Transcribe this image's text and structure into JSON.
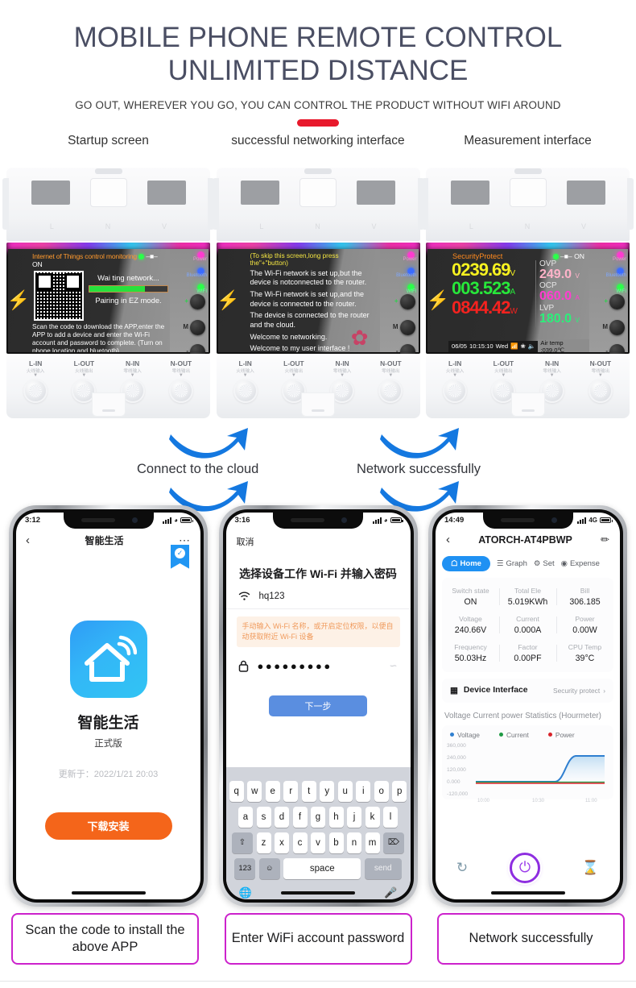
{
  "header": {
    "title": "MOBILE PHONE REMOTE CONTROL UNLIMITED DISTANCE",
    "subtitle": "GO OUT, WHEREVER YOU GO, YOU CAN CONTROL THE PRODUCT WITHOUT WIFI AROUND",
    "accent_color": "#e8192c",
    "title_color": "#4a4e63"
  },
  "devices": [
    {
      "caption": "Startup screen",
      "screen": {
        "title": "Internet of Things control monitoring",
        "switch_label": "ON",
        "waiting": "Wai ting network...",
        "progress_percent": 71,
        "pairing": "Pairing in EZ mode.",
        "footer": "Scan the code to download the APP,enter the APP to add a device and enter the Wi-Fi account and password to complete. (Turn on phone location and bluetooth)"
      }
    },
    {
      "caption": "successful networking interface",
      "screen": {
        "hint": "(To skip this screen,long press the\"+\"button)",
        "lines": [
          "The Wi-Fi network is set up,but the device is notconnected to the router.",
          "The Wi-Fi network is set up,and the device is connected to the router.",
          "The device is connected to the router and the cloud.",
          "Welcome to networking.",
          "Welcome to my user interface !"
        ]
      }
    },
    {
      "caption": "Measurement interface",
      "screen": {
        "mode": "SecurityProtect",
        "switch_label": "ON",
        "readings": [
          {
            "value": "0239.69",
            "unit": "V",
            "color": "#f7f220"
          },
          {
            "value": "003.523",
            "unit": "A",
            "color": "#27e83a"
          },
          {
            "value": "0844.42",
            "unit": "W",
            "color": "#f5221f"
          }
        ],
        "limits": [
          {
            "key": "OVP",
            "value": "249.0",
            "unit": "V"
          },
          {
            "key": "OCP",
            "value": "060.0",
            "unit": "A"
          },
          {
            "key": "LVP",
            "value": "180.0",
            "unit": "V"
          }
        ],
        "status_date": "06/05",
        "status_time": "10:15:10",
        "status_day": "Wed",
        "air_temp": "Air temp :039.0℃"
      }
    }
  ],
  "device_leds": {
    "power": "Power",
    "bluetooth": "Bluetooth",
    "wifi": "WIFI"
  },
  "device_buttons": {
    "plus": "+",
    "m": "M",
    "minus": "-"
  },
  "terminals": [
    {
      "label": "L-IN",
      "cn": "火线输入"
    },
    {
      "label": "L-OUT",
      "cn": "火线输出"
    },
    {
      "label": "N-IN",
      "cn": "零线输入"
    },
    {
      "label": "N-OUT",
      "cn": "零线输出"
    }
  ],
  "arrows": {
    "left_label": "Connect to the cloud",
    "right_label": "Network successfully",
    "color": "#1478e0"
  },
  "phone1": {
    "status_time": "3:12",
    "nav_title": "智能生活",
    "back_icon": "chevron-left-icon",
    "more_icon": "more-horizontal-icon",
    "badge_icon": "verified-check-icon",
    "app_icon": "smart-home-wifi-icon",
    "app_name": "智能生活",
    "app_version": "正式版",
    "updated": "更新于：2022/1/21 20:03",
    "download_label": "下载安装",
    "download_color": "#f4651a"
  },
  "phone2": {
    "status_time": "3:16",
    "cancel_label": "取消",
    "title": "选择设备工作 Wi-Fi 并输入密码",
    "wifi_icon": "wifi-icon",
    "ssid": "hq123",
    "ssid_placeholder": "Wi-Fi",
    "warning": "手动输入 Wi-Fi 名称，或开启定位权限，以便自动获取附近 Wi-Fi 设备",
    "lock_icon": "lock-icon",
    "password_masked": "●●●●●●●●●",
    "eye_icon": "eye-off-icon",
    "next_label": "下一步",
    "keyboard": {
      "row1": [
        "q",
        "w",
        "e",
        "r",
        "t",
        "y",
        "u",
        "i",
        "o",
        "p"
      ],
      "row2": [
        "a",
        "s",
        "d",
        "f",
        "g",
        "h",
        "j",
        "k",
        "l"
      ],
      "row3": [
        "z",
        "x",
        "c",
        "v",
        "b",
        "n",
        "m"
      ],
      "shift": "⇧",
      "backspace": "⌦",
      "numbers": "123",
      "emoji": "☺",
      "space": "space",
      "send": "send",
      "globe": "globe-icon",
      "mic": "microphone-icon"
    }
  },
  "phone3": {
    "status_time": "14:49",
    "network": "4G",
    "nav_title": "ATORCH-AT4PBWP",
    "back_icon": "chevron-left-icon",
    "edit_icon": "pencil-icon",
    "tabs": [
      {
        "label": "Home",
        "icon": "home-icon",
        "active": true
      },
      {
        "label": "Graph",
        "icon": "chart-icon",
        "active": false
      },
      {
        "label": "Set",
        "icon": "gear-icon",
        "active": false
      },
      {
        "label": "Expense",
        "icon": "clock-icon",
        "active": false
      }
    ],
    "metrics": [
      [
        {
          "key": "Switch state",
          "value": "ON"
        },
        {
          "key": "Total Ele",
          "value": "5.019KWh"
        },
        {
          "key": "Bill",
          "value": "306.185"
        }
      ],
      [
        {
          "key": "Voltage",
          "value": "240.66V"
        },
        {
          "key": "Current",
          "value": "0.000A"
        },
        {
          "key": "Power",
          "value": "0.00W"
        }
      ],
      [
        {
          "key": "Frequency",
          "value": "50.03Hz"
        },
        {
          "key": "Factor",
          "value": "0.00PF"
        },
        {
          "key": "CPU Temp",
          "value": "39°C"
        }
      ]
    ],
    "device_interface": {
      "icon": "grid-icon",
      "label": "Device Interface",
      "value": "Security protect",
      "chevron": "chevron-right-icon"
    },
    "controls": {
      "timer_icon": "timer-icon",
      "power_icon": "power-icon",
      "hourglass_icon": "hourglass-icon",
      "power_color": "#8e2ee0"
    }
  },
  "chart_data": {
    "type": "line",
    "title": "Voltage Current power Statistics (Hourmeter)",
    "legend": [
      {
        "name": "Voltage",
        "color": "#2f7fd0"
      },
      {
        "name": "Current",
        "color": "#1f9a44"
      },
      {
        "name": "Power",
        "color": "#d8232a"
      }
    ],
    "legend_position": "top",
    "grid": false,
    "ylabel": "",
    "xlabel": "",
    "ylim": [
      -120000,
      360000
    ],
    "yticks": [
      "360,000",
      "240,000",
      "120,000",
      "0.000",
      "-120,000"
    ],
    "xticks": [
      "10:00",
      "10:30",
      "11:00"
    ],
    "x": [
      0,
      1,
      2,
      3,
      4,
      5,
      6,
      7,
      8,
      9,
      10
    ],
    "series": [
      {
        "name": "Voltage",
        "values": [
          0,
          0,
          0,
          0,
          0,
          0,
          0,
          140000,
          245000,
          243000,
          243000
        ]
      },
      {
        "name": "Current",
        "values": [
          0,
          0,
          0,
          0,
          0,
          0,
          0,
          0,
          0,
          0,
          0
        ]
      },
      {
        "name": "Power",
        "values": [
          0,
          0,
          0,
          0,
          0,
          0,
          0,
          0,
          0,
          0,
          0
        ]
      }
    ]
  },
  "captions": [
    "Scan the code to install the above APP",
    "Enter WiFi account password",
    "Network successfully"
  ],
  "caption_border_color": "#cc22cc"
}
